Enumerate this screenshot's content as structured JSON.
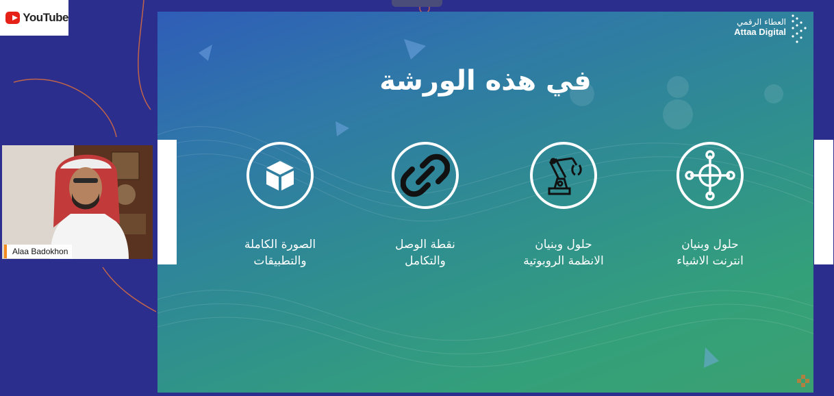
{
  "youtube": {
    "label": "YouTube",
    "icon": "youtube-play-icon"
  },
  "presenter": {
    "name": "Alaa Badokhon"
  },
  "slide": {
    "title": "في هذه الورشة",
    "logo_ar": "العطاء الرقمي",
    "logo_en": "Attaa Digital",
    "features": [
      {
        "icon": "box-icon",
        "line1": "الصورة الكاملة",
        "line2": "والتطبيقات"
      },
      {
        "icon": "chain-link-icon",
        "line1": "نقطة الوصل",
        "line2": "والتكامل"
      },
      {
        "icon": "robotic-arm-icon",
        "line1": "حلول وبنيان",
        "line2": "الانظمة الروبوتية"
      },
      {
        "icon": "iot-network-icon",
        "line1": "حلول وبنيان",
        "line2": "انترنت الاشياء"
      }
    ]
  },
  "colors": {
    "page_bg": "#2b2e8c",
    "slide_top": "#2f5db8",
    "slide_bottom": "#3aa070",
    "name_accent": "#f58a1f"
  }
}
